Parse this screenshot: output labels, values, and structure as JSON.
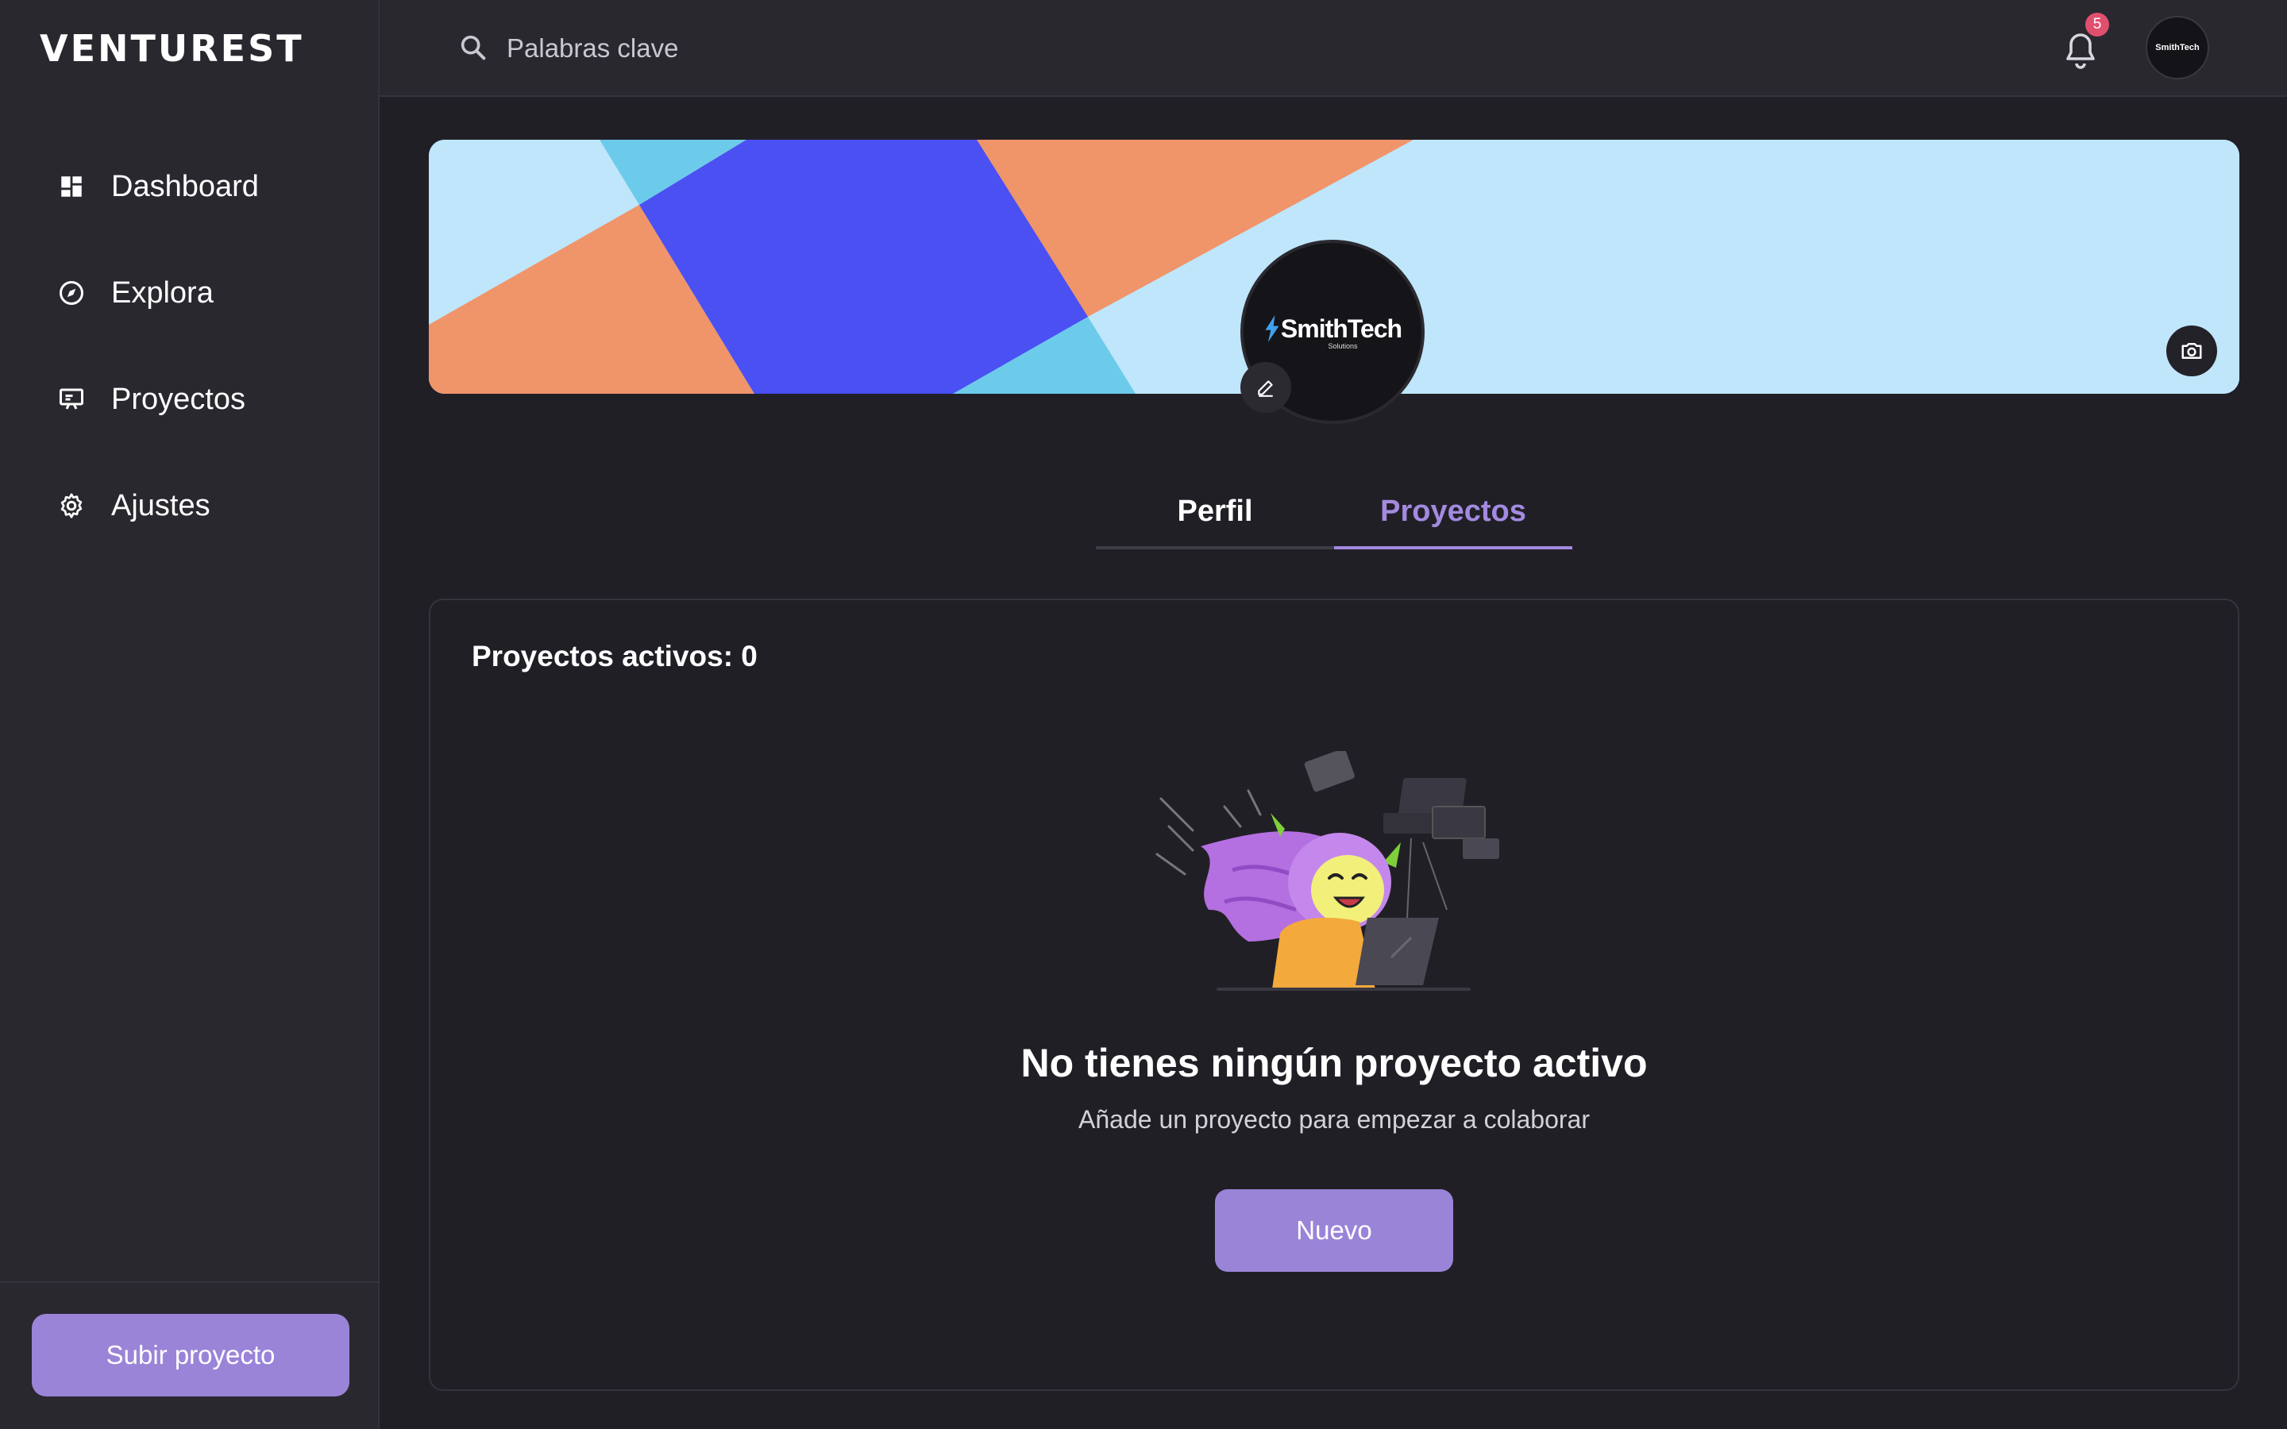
{
  "brand": "VENTUREST",
  "sidebar": {
    "items": [
      {
        "label": "Dashboard",
        "icon": "dashboard-icon"
      },
      {
        "label": "Explora",
        "icon": "compass-icon"
      },
      {
        "label": "Proyectos",
        "icon": "presentation-icon"
      },
      {
        "label": "Ajustes",
        "icon": "gear-icon"
      }
    ],
    "upload_label": "Subir proyecto"
  },
  "header": {
    "search_placeholder": "Palabras clave",
    "notification_count": "5",
    "avatar_text": "SmithTech"
  },
  "profile": {
    "company_name": "SmithTech",
    "company_sub": "Solutions"
  },
  "tabs": [
    {
      "label": "Perfil",
      "active": false
    },
    {
      "label": "Proyectos",
      "active": true
    }
  ],
  "projects": {
    "active_count_label": "Proyectos activos: 0",
    "empty_title": "No tienes ningún proyecto activo",
    "empty_subtitle": "Añade un proyecto para empezar a colaborar",
    "new_button": "Nuevo"
  },
  "colors": {
    "accent": "#9a84d8",
    "active_tab": "#a38ae0",
    "badge": "#e0506e",
    "background": "#211f26",
    "sidebar": "#2a282f"
  }
}
